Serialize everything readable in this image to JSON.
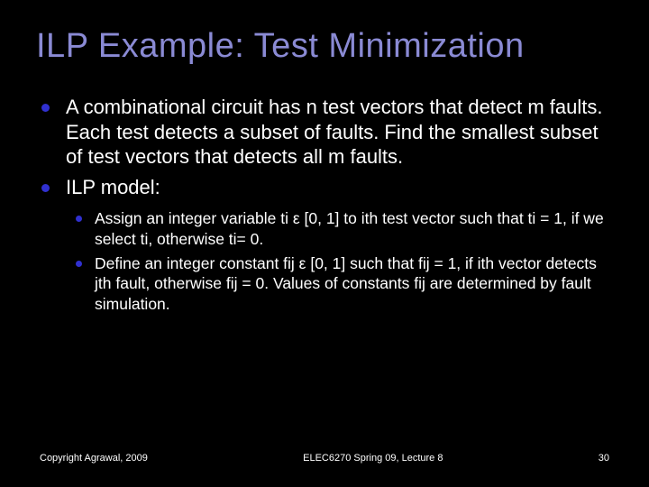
{
  "title": "ILP Example: Test Minimization",
  "bullets": [
    {
      "text": "A combinational circuit has n test vectors that detect m faults. Each test detects a subset of faults. Find the smallest subset of test vectors that detects all m faults."
    },
    {
      "text": "ILP model:"
    }
  ],
  "subbullets": [
    {
      "text": "Assign an integer variable ti ε [0, 1] to ith test vector such that ti = 1, if we select ti, otherwise ti= 0."
    },
    {
      "text": "Define an integer constant fij ε [0, 1] such that fij = 1, if ith vector detects jth fault, otherwise fij = 0. Values of constants fij are determined by fault simulation."
    }
  ],
  "footer": {
    "left": "Copyright Agrawal, 2009",
    "center": "ELEC6270 Spring 09, Lecture 8",
    "right": "30"
  }
}
